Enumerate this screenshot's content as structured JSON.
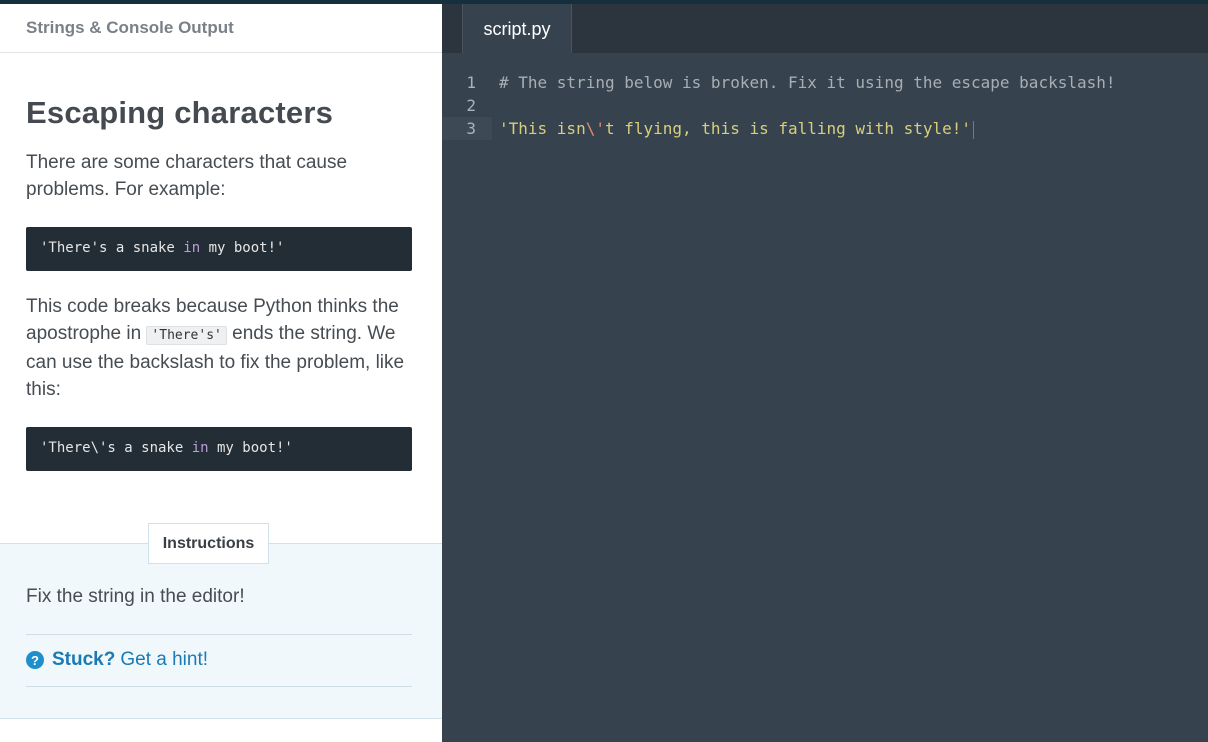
{
  "left_panel": {
    "header_title": "Strings & Console Output",
    "lesson_title": "Escaping characters",
    "intro_text": "There are some characters that cause problems. For example:",
    "code_example_1": {
      "before_kw": "'There's a snake ",
      "kw": "in",
      "after_kw": " my boot!'"
    },
    "explanation_part1": "This code breaks because Python thinks the apostrophe in ",
    "explanation_inline_code": "'There's'",
    "explanation_part2": " ends the string. We can use the backslash to fix the problem, like this:",
    "code_example_2": {
      "before_kw": "'There\\'s a snake ",
      "kw": "in",
      "after_kw": " my boot!'"
    },
    "instructions_tab": "Instructions",
    "instructions_text": "Fix the string in the editor!",
    "hint": {
      "icon": "?",
      "stuck_label": "Stuck?",
      "link_text": "Get a hint!"
    }
  },
  "editor": {
    "tab_name": "script.py",
    "lines": [
      {
        "number": "1",
        "text": "# The string below is broken. Fix it using the escape backslash!"
      },
      {
        "number": "2",
        "text": ""
      },
      {
        "number": "3",
        "before_escape": "'This isn",
        "escape": "\\'",
        "after_escape": "t flying, this is falling with style!'"
      }
    ]
  },
  "colors": {
    "editor_bg": "#36434f",
    "string": "#d8cf7a",
    "escape": "#e6896f",
    "comment": "#a8aeb3",
    "link": "#1a7ab5"
  }
}
